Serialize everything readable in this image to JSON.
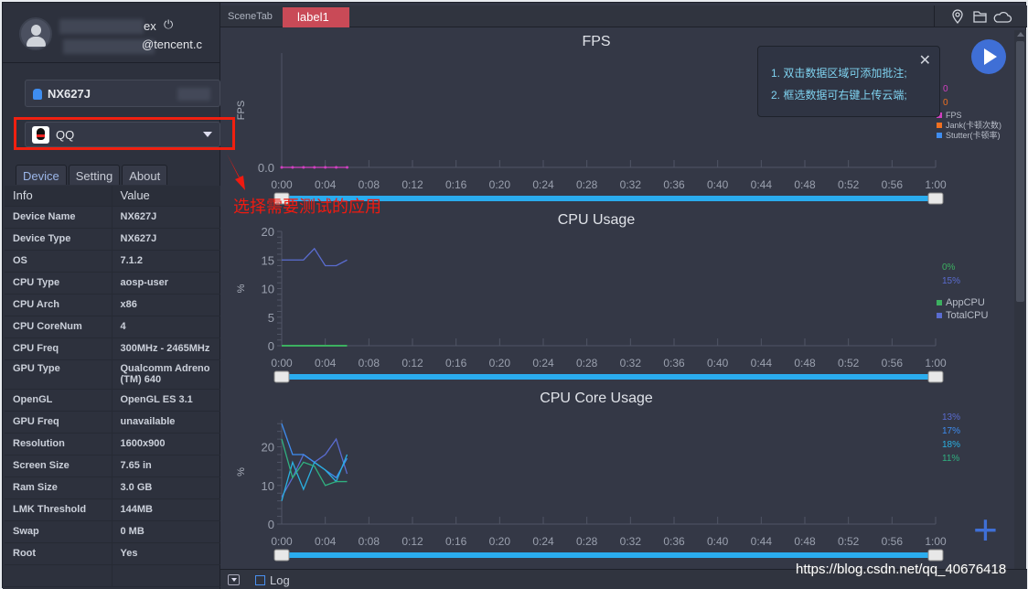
{
  "user": {
    "name_suffix": "ex",
    "email_suffix": "@tencent.c",
    "power_icon": "power-icon"
  },
  "device_selector": {
    "value": "NX627J",
    "icon": "android-icon"
  },
  "app_selector": {
    "value": "QQ",
    "icon": "qq-icon"
  },
  "side_tabs": [
    "Device",
    "Setting",
    "About"
  ],
  "info_table": {
    "headers": [
      "Info",
      "Value"
    ],
    "rows": [
      [
        "Device Name",
        "NX627J"
      ],
      [
        "Device Type",
        "NX627J"
      ],
      [
        "OS",
        "7.1.2"
      ],
      [
        "CPU Type",
        "aosp-user"
      ],
      [
        "CPU Arch",
        "x86"
      ],
      [
        "CPU CoreNum",
        "4"
      ],
      [
        "CPU Freq",
        "300MHz - 2465MHz"
      ],
      [
        "GPU Type",
        "Qualcomm Adreno (TM) 640"
      ],
      [
        "OpenGL",
        "OpenGL ES 3.1"
      ],
      [
        "GPU Freq",
        "unavailable"
      ],
      [
        "Resolution",
        "1600x900"
      ],
      [
        "Screen Size",
        "7.65 in"
      ],
      [
        "Ram Size",
        "3.0 GB"
      ],
      [
        "LMK Threshold",
        "144MB"
      ],
      [
        "Swap",
        "0 MB"
      ],
      [
        "Root",
        "Yes"
      ]
    ]
  },
  "top_tabs": {
    "scene": "SceneTab",
    "label": "label1"
  },
  "top_icons": [
    "location-icon",
    "folder-icon",
    "cloud-icon"
  ],
  "tooltip": {
    "line1": "1. 双击数据区域可添加批注;",
    "line2": "2. 框选数据可右键上传云端;"
  },
  "annotation": {
    "text": "选择需要测试的应用",
    "color": "#f01a10"
  },
  "bottom": {
    "log_label": "Log"
  },
  "watermark": "https://blog.csdn.net/qq_40676418",
  "chart_data": [
    {
      "id": "fps",
      "type": "line",
      "title": "FPS",
      "ylabel": "FPS",
      "xlim": [
        "0:00",
        "1:00"
      ],
      "ylim": [
        0,
        0
      ],
      "x_ticks": [
        "0:00",
        "0:04",
        "0:08",
        "0:12",
        "0:16",
        "0:20",
        "0:24",
        "0:28",
        "0:32",
        "0:36",
        "0:40",
        "0:44",
        "0:48",
        "0:52",
        "0:56",
        "1:00"
      ],
      "y_ticks": [
        "0.0"
      ],
      "series": [
        {
          "name": "FPS",
          "color": "#d040c0",
          "values": [
            0,
            0,
            0,
            0,
            0,
            0,
            0
          ],
          "current": "0"
        },
        {
          "name": "Jank(卡顿次数)",
          "color": "#f07020",
          "values": [],
          "current": "0"
        },
        {
          "name": "Stutter(卡顿率)",
          "color": "#3e8df0",
          "values": []
        }
      ]
    },
    {
      "id": "cpu",
      "type": "line",
      "title": "CPU Usage",
      "ylabel": "%",
      "ylim": [
        0,
        20
      ],
      "y_ticks": [
        "0",
        "5",
        "10",
        "15",
        "20"
      ],
      "series": [
        {
          "name": "AppCPU",
          "color": "#3cb060",
          "values": [
            0,
            0,
            0,
            0,
            0,
            0,
            0
          ],
          "current": "0%"
        },
        {
          "name": "TotalCPU",
          "color": "#5a6cd0",
          "values": [
            15,
            15,
            15,
            17,
            14,
            14,
            15
          ],
          "current": "15%"
        }
      ]
    },
    {
      "id": "core",
      "type": "line",
      "title": "CPU Core Usage",
      "ylabel": "%",
      "ylim": [
        0,
        27
      ],
      "y_ticks": [
        "0",
        "10",
        "20"
      ],
      "series": [
        {
          "color": "#5a6cd0",
          "values": [
            7,
            12,
            18,
            16,
            18,
            22,
            13
          ],
          "current": "13%"
        },
        {
          "color": "#3e8df0",
          "values": [
            26,
            18,
            18,
            16,
            14,
            12,
            17
          ],
          "current": "17%"
        },
        {
          "color": "#2ab0e0",
          "values": [
            6,
            16,
            9,
            16,
            14,
            11,
            18
          ],
          "current": "18%"
        },
        {
          "color": "#30b080",
          "values": [
            22,
            12,
            16,
            15,
            10,
            11,
            11
          ],
          "current": "11%"
        }
      ]
    }
  ]
}
